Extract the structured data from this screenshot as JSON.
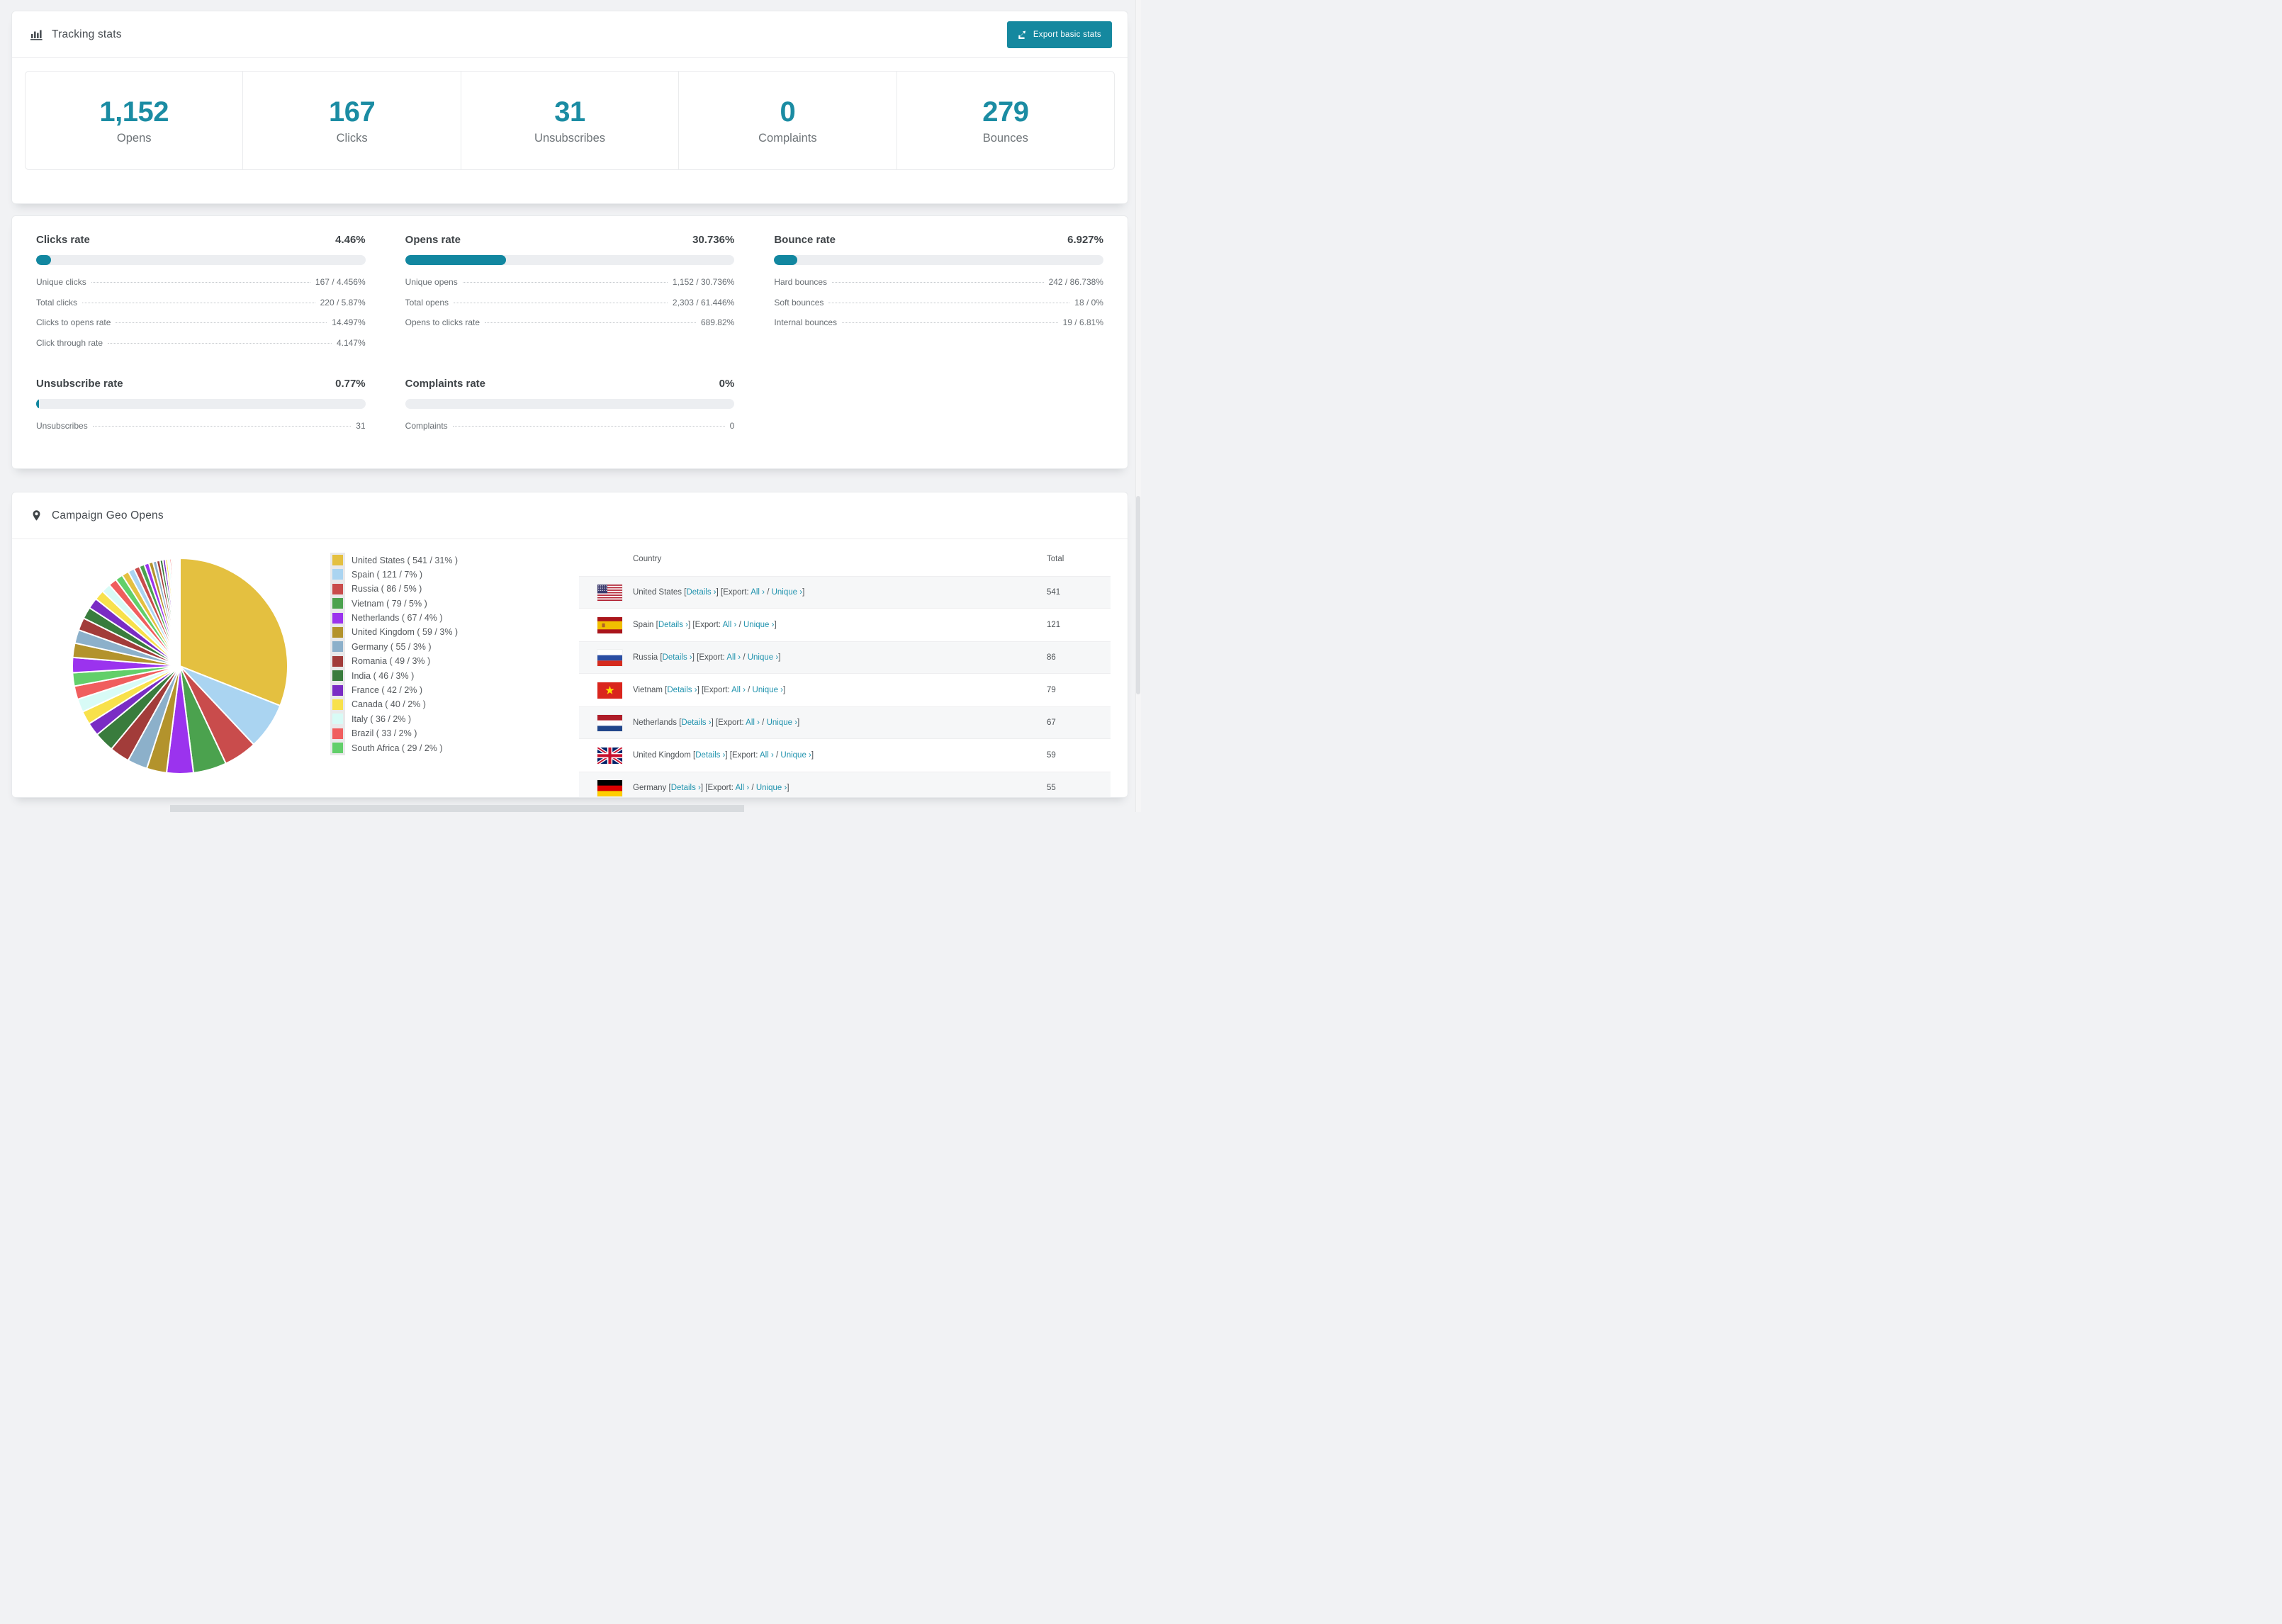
{
  "tracking": {
    "title": "Tracking stats",
    "export_button": "Export basic stats",
    "stats": [
      {
        "value": "1,152",
        "label": "Opens"
      },
      {
        "value": "167",
        "label": "Clicks"
      },
      {
        "value": "31",
        "label": "Unsubscribes"
      },
      {
        "value": "0",
        "label": "Complaints"
      },
      {
        "value": "279",
        "label": "Bounces"
      }
    ]
  },
  "rates": {
    "sections": [
      {
        "title": "Clicks rate",
        "value": "4.46%",
        "percent": 4.46,
        "rows": [
          {
            "label": "Unique clicks",
            "value": "167 / 4.456%"
          },
          {
            "label": "Total clicks",
            "value": "220 / 5.87%"
          },
          {
            "label": "Clicks to opens rate",
            "value": "14.497%"
          },
          {
            "label": "Click through rate",
            "value": "4.147%"
          }
        ]
      },
      {
        "title": "Opens rate",
        "value": "30.736%",
        "percent": 30.736,
        "rows": [
          {
            "label": "Unique opens",
            "value": "1,152 / 30.736%"
          },
          {
            "label": "Total opens",
            "value": "2,303 / 61.446%"
          },
          {
            "label": "Opens to clicks rate",
            "value": "689.82%"
          }
        ]
      },
      {
        "title": "Bounce rate",
        "value": "6.927%",
        "percent": 6.927,
        "rows": [
          {
            "label": "Hard bounces",
            "value": "242 / 86.738%"
          },
          {
            "label": "Soft bounces",
            "value": "18 / 0%"
          },
          {
            "label": "Internal bounces",
            "value": "19 / 6.81%"
          }
        ]
      },
      {
        "title": "Unsubscribe rate",
        "value": "0.77%",
        "percent": 0.77,
        "rows": [
          {
            "label": "Unsubscribes",
            "value": "31"
          }
        ]
      },
      {
        "title": "Complaints rate",
        "value": "0%",
        "percent": 0,
        "rows": [
          {
            "label": "Complaints",
            "value": "0"
          }
        ]
      }
    ]
  },
  "geo": {
    "title": "Campaign Geo Opens",
    "table": {
      "columns": [
        "Country",
        "Total"
      ],
      "links": {
        "details": "Details",
        "export_prefix": "Export:",
        "all": "All",
        "unique": "Unique",
        "chevron": "›"
      },
      "rows": [
        {
          "country": "United States",
          "flag": "us",
          "total": "541"
        },
        {
          "country": "Spain",
          "flag": "es",
          "total": "121"
        },
        {
          "country": "Russia",
          "flag": "ru",
          "total": "86"
        },
        {
          "country": "Vietnam",
          "flag": "vn",
          "total": "79"
        },
        {
          "country": "Netherlands",
          "flag": "nl",
          "total": "67"
        },
        {
          "country": "United Kingdom",
          "flag": "gb",
          "total": "59"
        },
        {
          "country": "Germany",
          "flag": "de",
          "total": "55"
        }
      ]
    }
  },
  "chart_data": {
    "type": "pie",
    "title": "Campaign Geo Opens",
    "legend_position": "right",
    "start_angle": "top",
    "direction": "clockwise",
    "gap_color": "#ffffff",
    "slices": [
      {
        "label": "United States",
        "value": 541,
        "pct": 31,
        "color": "#e4c040"
      },
      {
        "label": "Spain",
        "value": 121,
        "pct": 7,
        "color": "#aad4f1"
      },
      {
        "label": "Russia",
        "value": 86,
        "pct": 5,
        "color": "#c94c4c"
      },
      {
        "label": "Vietnam",
        "value": 79,
        "pct": 5,
        "color": "#4ba24e"
      },
      {
        "label": "Netherlands",
        "value": 67,
        "pct": 4,
        "color": "#9b33ee"
      },
      {
        "label": "United Kingdom",
        "value": 59,
        "pct": 3,
        "color": "#b3932c"
      },
      {
        "label": "Germany",
        "value": 55,
        "pct": 3,
        "color": "#8cb0ca"
      },
      {
        "label": "Romania",
        "value": 49,
        "pct": 3,
        "color": "#a23c3a"
      },
      {
        "label": "India",
        "value": 46,
        "pct": 3,
        "color": "#397c3d"
      },
      {
        "label": "France",
        "value": 42,
        "pct": 2,
        "color": "#7a2cc4"
      },
      {
        "label": "Canada",
        "value": 40,
        "pct": 2,
        "color": "#f8e14b"
      },
      {
        "label": "Italy",
        "value": 36,
        "pct": 2,
        "color": "#d8fbf6"
      },
      {
        "label": "Brazil",
        "value": 33,
        "pct": 2,
        "color": "#f05e5e"
      },
      {
        "label": "South Africa",
        "value": 29,
        "pct": 2,
        "color": "#62cf6a"
      }
    ],
    "other_slices_pct_total": 26,
    "other_slices_relative": [
      1.75,
      1.65,
      1.55,
      1.45,
      1.35,
      1.25,
      1.15,
      1.05,
      0.95,
      0.88,
      0.8,
      0.73,
      0.66,
      0.6,
      0.54,
      0.48,
      0.43,
      0.38,
      0.34,
      0.3,
      0.26,
      0.23,
      0.2,
      0.17,
      0.15,
      0.13,
      0.11,
      0.09,
      0.08,
      0.07,
      0.06,
      0.05,
      0.04,
      0.03
    ]
  },
  "colors": {
    "accent": "#15889f",
    "link": "#2193ae",
    "stat_number": "#1b8ca3",
    "bar_fill": "#1287a0",
    "bar_track": "#eceef1",
    "row_stripe": "#f6f7f8"
  }
}
